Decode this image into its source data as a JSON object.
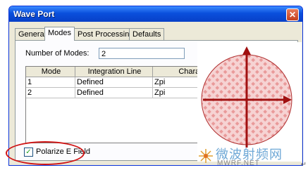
{
  "window": {
    "title": "Wave Port",
    "close_glyph": "✕"
  },
  "tabs": [
    {
      "label": "General"
    },
    {
      "label": "Modes"
    },
    {
      "label": "Post Processing"
    },
    {
      "label": "Defaults"
    }
  ],
  "modes": {
    "label": "Number of Modes:",
    "value": "2"
  },
  "grid": {
    "columns": [
      "Mode",
      "Integration Line",
      "Character"
    ],
    "rows": [
      [
        "1",
        "Defined",
        "Zpi"
      ],
      [
        "2",
        "Defined",
        "Zpi"
      ]
    ]
  },
  "polarize": {
    "label": "Polarize E Field",
    "checked": true,
    "check_glyph": "✓"
  },
  "watermark": {
    "cn": "微波射频网",
    "url": "MWRF.NET"
  },
  "colors": {
    "highlight": "#d01616",
    "title_bar": "#0a4fdc",
    "pattern": "#e99a9a"
  },
  "icons": [
    "close-icon",
    "check-icon",
    "arrow-icon",
    "watermark-logo-icon"
  ],
  "footer_mark": "↵"
}
